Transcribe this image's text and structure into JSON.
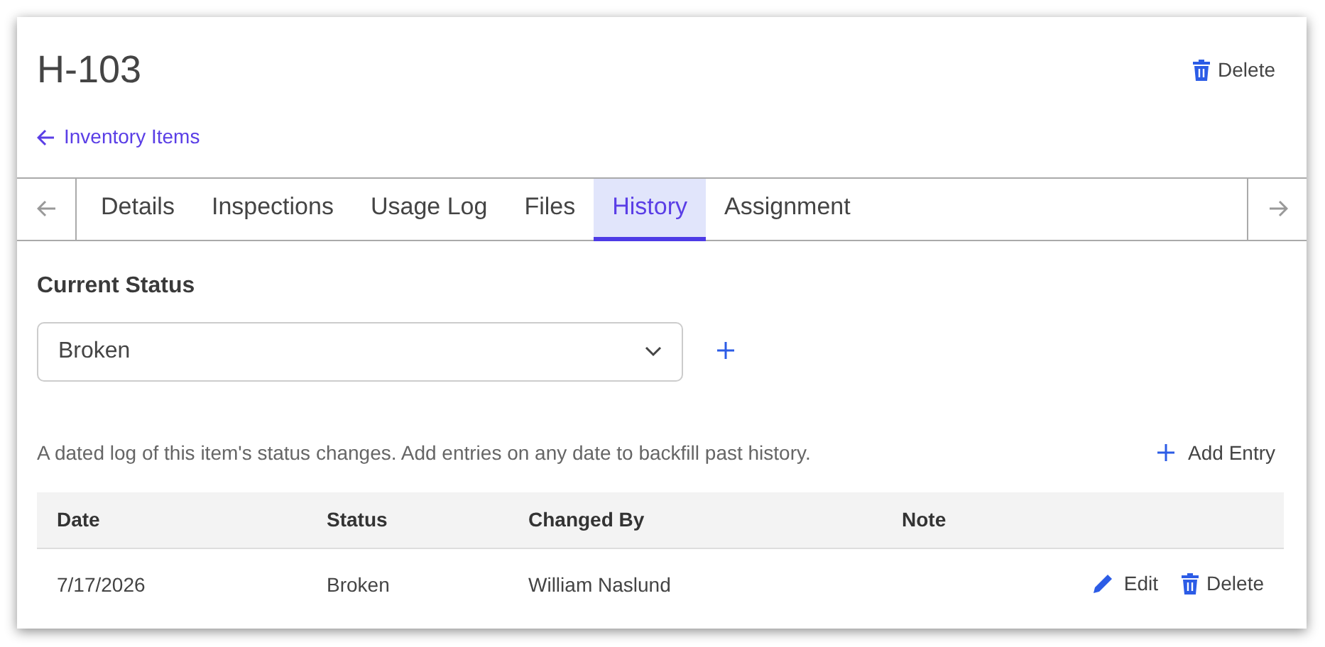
{
  "title": "H-103",
  "header_actions": [
    {
      "label": "Delete",
      "kind": "delete"
    }
  ],
  "back_link": {
    "label": "Inventory Items"
  },
  "tabs": [
    {
      "label": "Details",
      "selected": false
    },
    {
      "label": "Inspections",
      "selected": false
    },
    {
      "label": "Usage Log",
      "selected": false
    },
    {
      "label": "Files",
      "selected": false
    },
    {
      "label": "History",
      "selected": true
    },
    {
      "label": "Assignment",
      "selected": false
    }
  ],
  "current_status": {
    "label": "Current Status",
    "value": "Broken"
  },
  "description": "A dated log of this item's status changes. Add entries on any date to backfill past history.",
  "add_entry": {
    "label": "Add Entry"
  },
  "table": {
    "columns": [
      "Date",
      "Status",
      "Changed By",
      "Note"
    ],
    "rows": [
      {
        "cells": [
          "7/17/2026",
          "Broken",
          "William Naslund",
          ""
        ],
        "actions": [
          {
            "label": "Edit",
            "kind": "edit"
          },
          {
            "label": "Delete",
            "kind": "delete"
          }
        ]
      }
    ]
  }
}
